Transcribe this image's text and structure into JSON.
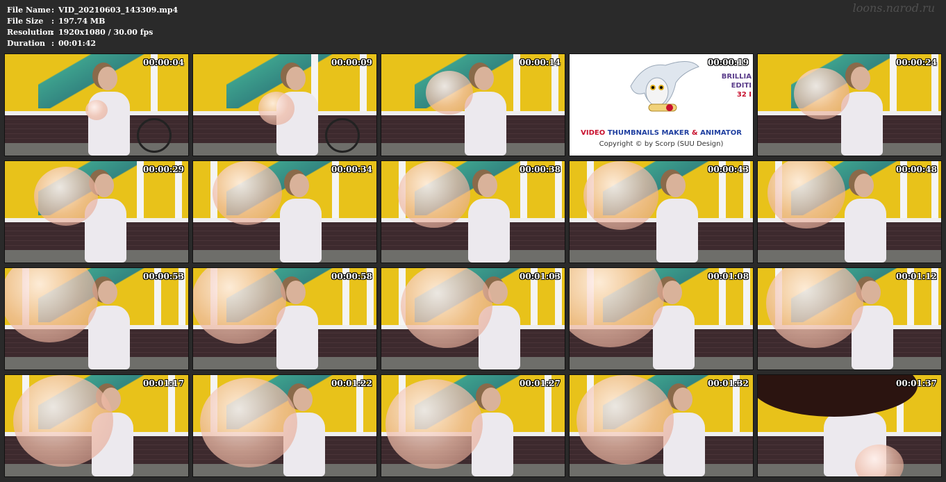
{
  "info": {
    "rows": [
      {
        "label": "File Name",
        "sep": ":",
        "value": "VID_20210603_143309.mp4"
      },
      {
        "label": "File Size",
        "sep": ":",
        "value": "197.74 MB"
      },
      {
        "label": "Resolution",
        "sep": ":",
        "value": "1920x1080 / 30.00 fps"
      },
      {
        "label": "Duration",
        "sep": ":",
        "value": "00:01:42"
      }
    ]
  },
  "watermark": "loons.narod.ru",
  "promo": {
    "title_part1": "VIDEO ",
    "title_part2": "THUMBNAILS MAKER",
    "title_part3": " & ",
    "title_part4": "ANIMATOR",
    "copyright": "Copyright © by Scorp (SUU Design)",
    "side_line1": "BRILLIA",
    "side_line2": "EDITI",
    "side_line3": "32 I"
  },
  "thumbnails": [
    {
      "time": "00:00:04"
    },
    {
      "time": "00:00:09"
    },
    {
      "time": "00:00:14"
    },
    {
      "time": "00:00:19"
    },
    {
      "time": "00:00:24"
    },
    {
      "time": "00:00:29"
    },
    {
      "time": "00:00:34"
    },
    {
      "time": "00:00:38"
    },
    {
      "time": "00:00:43"
    },
    {
      "time": "00:00:48"
    },
    {
      "time": "00:00:53"
    },
    {
      "time": "00:00:58"
    },
    {
      "time": "00:01:03"
    },
    {
      "time": "00:01:08"
    },
    {
      "time": "00:01:12"
    },
    {
      "time": "00:01:17"
    },
    {
      "time": "00:01:22"
    },
    {
      "time": "00:01:27"
    },
    {
      "time": "00:01:32"
    },
    {
      "time": "00:01:37"
    }
  ],
  "colors": {
    "background": "#2a2a2a",
    "wall_yellow": "#e8c21a",
    "stripe_teal": "#2a9d9a",
    "brick": "#3d2a2e"
  }
}
